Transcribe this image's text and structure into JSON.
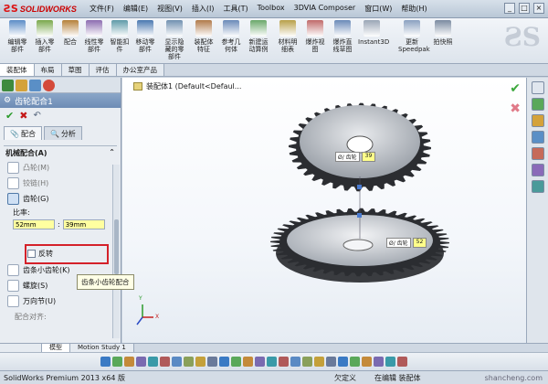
{
  "app": {
    "logo_text": "SOLIDWORKS",
    "menus": [
      "文件(F)",
      "编辑(E)",
      "视图(V)",
      "插入(I)",
      "工具(T)",
      "Toolbox",
      "3DVIA Composer",
      "窗口(W)",
      "帮助(H)"
    ]
  },
  "commands": [
    {
      "label": "编辑零\n部件",
      "color": "#5b8cc6"
    },
    {
      "label": "插入零\n部件",
      "color": "#7aa84c"
    },
    {
      "label": "配合",
      "color": "#b5813a"
    },
    {
      "label": "线性零\n部件",
      "color": "#8c6cb0"
    },
    {
      "label": "智能扣\n件",
      "color": "#5e9aa8"
    },
    {
      "label": "移动零\n部件",
      "color": "#4a78b0"
    },
    {
      "label": "显示隐\n藏的零\n部件",
      "color": "#7090b0"
    },
    {
      "label": "装配体\n特征",
      "color": "#b07a4a"
    },
    {
      "label": "参考几\n何体",
      "color": "#6a8ab8"
    },
    {
      "label": "新建运\n动算例",
      "color": "#6aa86a"
    },
    {
      "label": "材料明\n细表",
      "color": "#b8a04a"
    },
    {
      "label": "爆炸视\n图",
      "color": "#c06a6a"
    },
    {
      "label": "爆炸直\n线草图",
      "color": "#6a8ab8"
    },
    {
      "label": "Instant3D",
      "color": "#9aa6b6"
    },
    {
      "label": "更新\nSpeedpak",
      "color": "#8aa0c0"
    },
    {
      "label": "拍快照",
      "color": "#7a8aa0"
    }
  ],
  "cmd_tabs": [
    "装配体",
    "布局",
    "草图",
    "评估",
    "办公室产品"
  ],
  "property_manager": {
    "title": "齿轮配合1",
    "subtabs": [
      "配合",
      "分析"
    ],
    "group_title": "机械配合(A)",
    "options": [
      {
        "label": "凸轮(M)",
        "enabled": false,
        "selected": false
      },
      {
        "label": "铰链(H)",
        "enabled": false,
        "selected": false
      },
      {
        "label": "齿轮(G)",
        "enabled": true,
        "selected": true
      }
    ],
    "ratio_label": "比率:",
    "ratio_a": "52mm",
    "ratio_b": "39mm",
    "reverse_label": "反转",
    "options_after": [
      {
        "label": "齿条小齿轮(K)",
        "enabled": true
      },
      {
        "label": "螺旋(S)",
        "enabled": true
      },
      {
        "label": "万向节(U)",
        "enabled": true
      },
      {
        "label": "配合对齐:",
        "enabled": false
      }
    ]
  },
  "viewport": {
    "breadcrumb": "装配体1  (Default<Defaul...",
    "tooltip": "齿条小齿轮配合",
    "dim_top_label": "Ø/ 齿轮",
    "dim_top_value": "39",
    "dim_bottom_label": "Ø/ 齿轮",
    "dim_bottom_value": "52",
    "axis_y": "Y",
    "axis_x": "X"
  },
  "bottom_tabs": [
    "模型",
    "Motion Study 1"
  ],
  "status": {
    "product": "SolidWorks Premium 2013 x64 版",
    "state1": "欠定义",
    "state2": "在编辑 装配体",
    "watermark": "shancheng.com"
  }
}
